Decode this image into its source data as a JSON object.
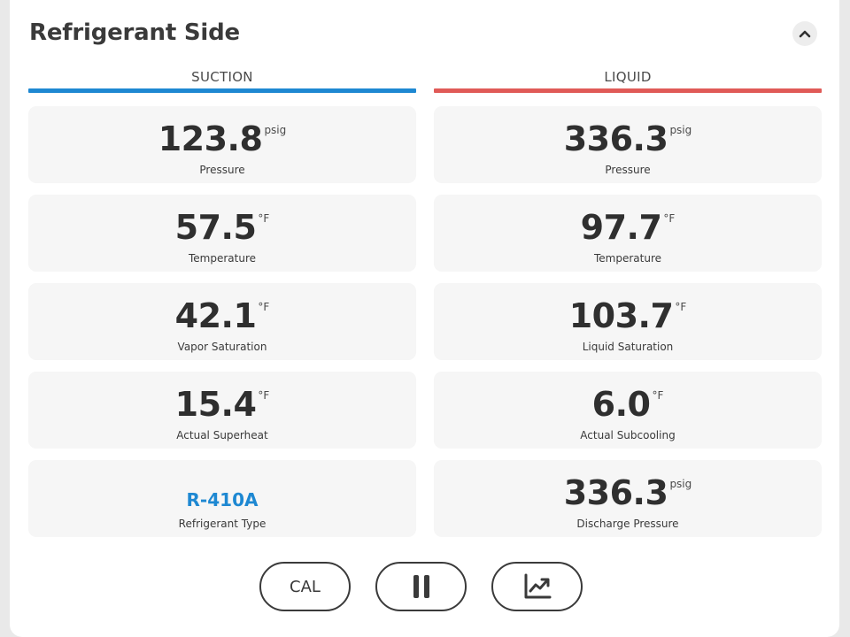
{
  "header": {
    "title": "Refrigerant Side",
    "collapse_icon": "chevron-up-icon"
  },
  "colors": {
    "suction": "#1e88d2",
    "liquid": "#e05a57",
    "accent_text": "#1e88d2"
  },
  "suction": {
    "heading": "SUCTION",
    "cards": [
      {
        "value": "123.8",
        "unit": "psig",
        "label": "Pressure"
      },
      {
        "value": "57.5",
        "unit": "°F",
        "label": "Temperature"
      },
      {
        "value": "42.1",
        "unit": "°F",
        "label": "Vapor Saturation"
      },
      {
        "value": "15.4",
        "unit": "°F",
        "label": "Actual Superheat"
      },
      {
        "value": "R-410A",
        "unit": "",
        "label": "Refrigerant Type"
      }
    ]
  },
  "liquid": {
    "heading": "LIQUID",
    "cards": [
      {
        "value": "336.3",
        "unit": "psig",
        "label": "Pressure"
      },
      {
        "value": "97.7",
        "unit": "°F",
        "label": "Temperature"
      },
      {
        "value": "103.7",
        "unit": "°F",
        "label": "Liquid Saturation"
      },
      {
        "value": "6.0",
        "unit": "°F",
        "label": "Actual Subcooling"
      },
      {
        "value": "336.3",
        "unit": "psig",
        "label": "Discharge Pressure"
      }
    ]
  },
  "controls": {
    "cal_label": "CAL",
    "pause_icon": "pause-icon",
    "graph_icon": "trending-chart-icon"
  }
}
